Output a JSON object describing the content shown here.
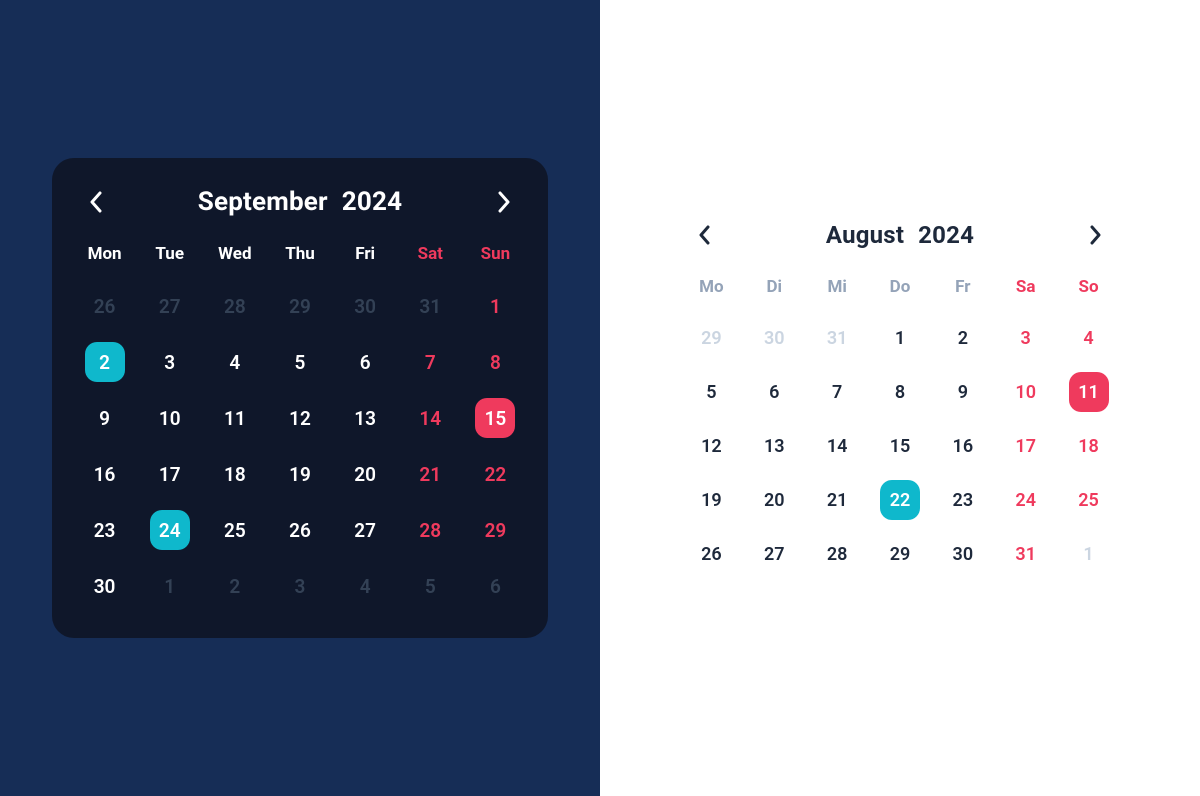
{
  "colors": {
    "cyan": "#0fb8cc",
    "red": "#ef3a5d",
    "darkPane": "#162d56",
    "darkCard": "#0f172a"
  },
  "left": {
    "month": "September",
    "year": "2024",
    "dow": [
      "Mon",
      "Tue",
      "Wed",
      "Thu",
      "Fri",
      "Sat",
      "Sun"
    ],
    "days": [
      {
        "n": "26",
        "out": true
      },
      {
        "n": "27",
        "out": true
      },
      {
        "n": "28",
        "out": true
      },
      {
        "n": "29",
        "out": true
      },
      {
        "n": "30",
        "out": true
      },
      {
        "n": "31",
        "out": true,
        "weekend": true
      },
      {
        "n": "1",
        "weekend": true
      },
      {
        "n": "2",
        "sel": "cyan"
      },
      {
        "n": "3"
      },
      {
        "n": "4"
      },
      {
        "n": "5"
      },
      {
        "n": "6"
      },
      {
        "n": "7",
        "weekend": true
      },
      {
        "n": "8",
        "weekend": true
      },
      {
        "n": "9"
      },
      {
        "n": "10"
      },
      {
        "n": "11"
      },
      {
        "n": "12"
      },
      {
        "n": "13"
      },
      {
        "n": "14",
        "weekend": true
      },
      {
        "n": "15",
        "weekend": true,
        "sel": "red"
      },
      {
        "n": "16"
      },
      {
        "n": "17"
      },
      {
        "n": "18"
      },
      {
        "n": "19"
      },
      {
        "n": "20"
      },
      {
        "n": "21",
        "weekend": true
      },
      {
        "n": "22",
        "weekend": true
      },
      {
        "n": "23"
      },
      {
        "n": "24",
        "sel": "cyan"
      },
      {
        "n": "25"
      },
      {
        "n": "26"
      },
      {
        "n": "27"
      },
      {
        "n": "28",
        "weekend": true
      },
      {
        "n": "29",
        "weekend": true
      },
      {
        "n": "30"
      },
      {
        "n": "1",
        "out": true
      },
      {
        "n": "2",
        "out": true
      },
      {
        "n": "3",
        "out": true
      },
      {
        "n": "4",
        "out": true
      },
      {
        "n": "5",
        "out": true,
        "weekend": true
      },
      {
        "n": "6",
        "out": true,
        "weekend": true
      }
    ]
  },
  "right": {
    "month": "August",
    "year": "2024",
    "dow": [
      "Mo",
      "Di",
      "Mi",
      "Do",
      "Fr",
      "Sa",
      "So"
    ],
    "days": [
      {
        "n": "29",
        "out": true
      },
      {
        "n": "30",
        "out": true
      },
      {
        "n": "31",
        "out": true
      },
      {
        "n": "1"
      },
      {
        "n": "2"
      },
      {
        "n": "3",
        "weekend": true
      },
      {
        "n": "4",
        "weekend": true
      },
      {
        "n": "5"
      },
      {
        "n": "6"
      },
      {
        "n": "7"
      },
      {
        "n": "8"
      },
      {
        "n": "9"
      },
      {
        "n": "10",
        "weekend": true
      },
      {
        "n": "11",
        "weekend": true,
        "sel": "red"
      },
      {
        "n": "12"
      },
      {
        "n": "13"
      },
      {
        "n": "14"
      },
      {
        "n": "15"
      },
      {
        "n": "16"
      },
      {
        "n": "17",
        "weekend": true
      },
      {
        "n": "18",
        "weekend": true
      },
      {
        "n": "19"
      },
      {
        "n": "20"
      },
      {
        "n": "21"
      },
      {
        "n": "22",
        "sel": "cyan"
      },
      {
        "n": "23"
      },
      {
        "n": "24",
        "weekend": true
      },
      {
        "n": "25",
        "weekend": true
      },
      {
        "n": "26"
      },
      {
        "n": "27"
      },
      {
        "n": "28"
      },
      {
        "n": "29"
      },
      {
        "n": "30"
      },
      {
        "n": "31",
        "weekend": true
      },
      {
        "n": "1",
        "out": true,
        "weekend": true
      }
    ]
  }
}
